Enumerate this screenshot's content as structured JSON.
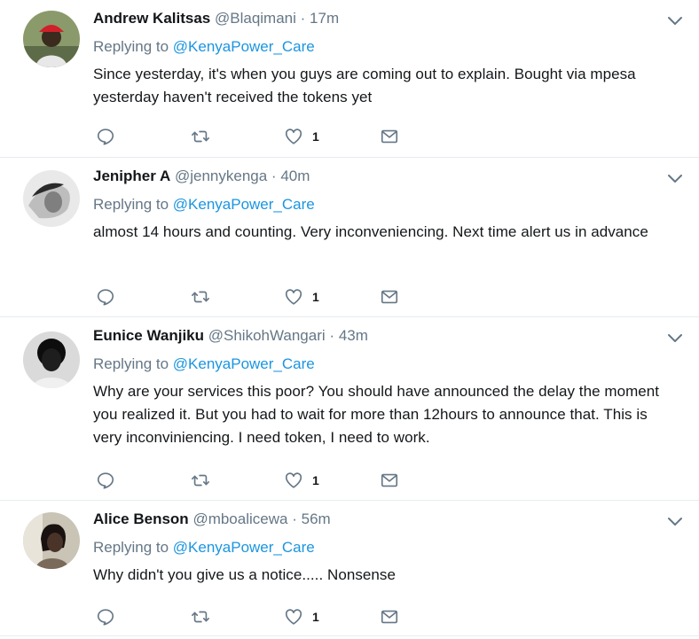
{
  "tweets": [
    {
      "name": "Andrew Kalitsas",
      "handle": "@Blaqimani",
      "dot": "·",
      "time": "17m",
      "replying_prefix": "Replying to ",
      "replying_to": "@KenyaPower_Care",
      "text": "Since yesterday, it's when you guys are coming out to explain. Bought via mpesa yesterday haven't received the tokens yet",
      "likes": "1",
      "avatar_colors": {
        "bg": "#8a9a6b",
        "skin": "#3b2a1e",
        "cap": "#d0202a",
        "shirt": "#e8e8e8"
      }
    },
    {
      "name": "Jenipher A",
      "handle": "@jennykenga",
      "dot": "·",
      "time": "40m",
      "replying_prefix": "Replying to ",
      "replying_to": "@KenyaPower_Care",
      "text": "almost 14 hours and counting. Very inconveniencing. Next time alert us in advance",
      "likes": "1",
      "avatar_colors": {
        "bg": "#e9e9e9",
        "skin": "#6b6b6b",
        "hair": "#2a2a2a",
        "shirt": "#bdbdbd"
      }
    },
    {
      "name": "Eunice Wanjiku",
      "handle": "@ShikohWangari",
      "dot": "·",
      "time": "43m",
      "replying_prefix": "Replying to ",
      "replying_to": "@KenyaPower_Care",
      "text": "Why are your services this poor? You should have announced the delay the moment you realized it. But you had to wait for more than 12hours to announce that. This is very inconviniencing. I need token,  I need to work.",
      "likes": "1",
      "avatar_colors": {
        "bg": "#dadada",
        "skin": "#1e1e1e",
        "hair": "#0d0d0d",
        "shirt": "#f0f0f0"
      }
    },
    {
      "name": "Alice Benson",
      "handle": "@mboalicewa",
      "dot": "·",
      "time": "56m",
      "replying_prefix": "Replying to ",
      "replying_to": "@KenyaPower_Care",
      "text": "Why didn't you give us a notice..... Nonsense",
      "likes": "1",
      "avatar_colors": {
        "bg": "#c9c4b5",
        "skin": "#4a3328",
        "hair": "#1a1210",
        "shirt": "#7a6a5a"
      }
    }
  ],
  "icons": {
    "reply": "reply-icon",
    "retweet": "retweet-icon",
    "like": "heart-icon",
    "dm": "envelope-icon",
    "more": "chevron-down-icon"
  },
  "colors": {
    "link": "#1b95e0",
    "muted": "#657786",
    "divider": "#e6ecf0"
  }
}
